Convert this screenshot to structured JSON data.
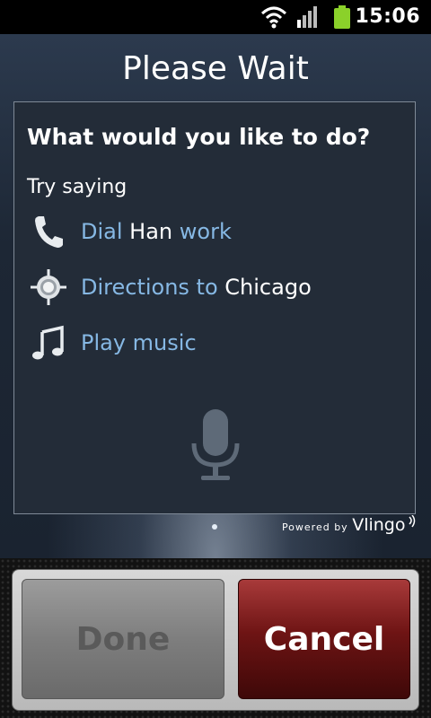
{
  "status_bar": {
    "time": "15:06"
  },
  "dialog": {
    "title": "Please Wait",
    "question": "What would you like to do?",
    "hint": "Try saying",
    "commands": [
      {
        "icon": "phone-icon",
        "keyword": "Dial",
        "value": "Han",
        "keyword2": "work"
      },
      {
        "icon": "location-target-icon",
        "keyword": "Directions to",
        "value": "Chicago"
      },
      {
        "icon": "music-note-icon",
        "keyword": "Play music"
      }
    ],
    "powered_by": "Powered by",
    "brand": "Vlingo"
  },
  "buttons": {
    "done": "Done",
    "cancel": "Cancel"
  },
  "colors": {
    "keyword": "#86b8e4",
    "cancel": "#6e1414",
    "panel": "#232c38"
  }
}
